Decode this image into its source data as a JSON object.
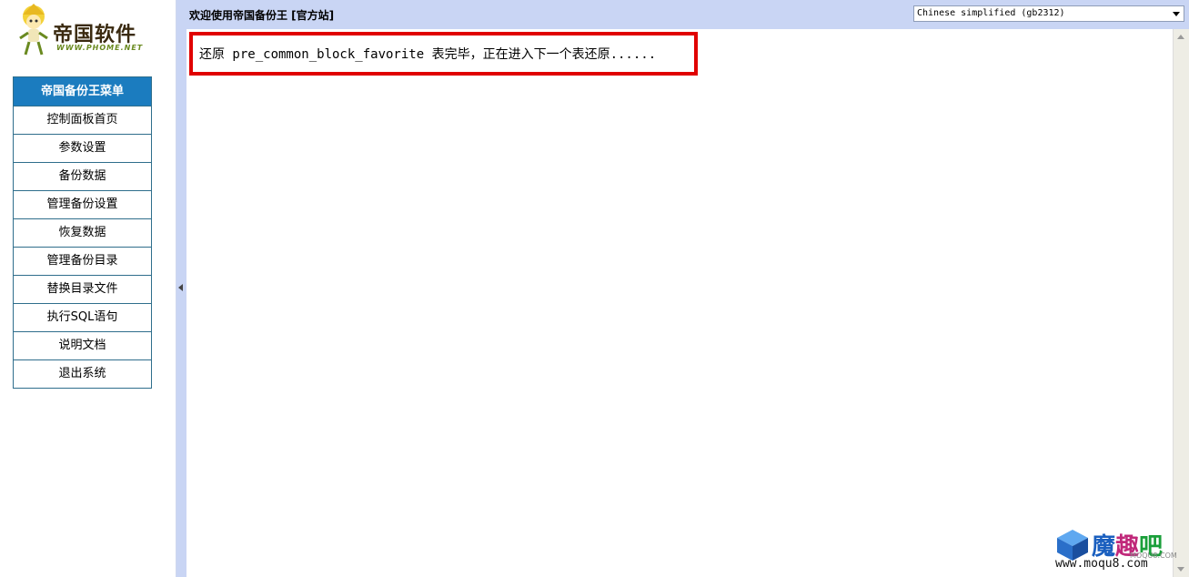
{
  "logo": {
    "name": "帝国软件",
    "url": "WWW.PHOME.NET"
  },
  "menu": {
    "title": "帝国备份王菜单",
    "items": [
      {
        "label": "控制面板首页"
      },
      {
        "label": "参数设置"
      },
      {
        "label": "备份数据"
      },
      {
        "label": "管理备份设置"
      },
      {
        "label": "恢复数据"
      },
      {
        "label": "管理备份目录"
      },
      {
        "label": "替换目录文件"
      },
      {
        "label": "执行SQL语句"
      },
      {
        "label": "说明文档"
      },
      {
        "label": "退出系统"
      }
    ]
  },
  "header": {
    "welcome": "欢迎使用帝国备份王 [官方站]",
    "language_selected": "Chinese simplified (gb2312)"
  },
  "main": {
    "status_message": "还原 pre_common_block_favorite 表完毕，正在进入下一个表还原......"
  },
  "watermark": {
    "cn": "魔趣吧",
    "sub": "MOQU8.COM",
    "site": "www.moqu8.com"
  },
  "colors": {
    "menu_header_bg": "#1b7cbf",
    "frame_bg": "#c9d5f4",
    "highlight_border": "#e00000"
  }
}
